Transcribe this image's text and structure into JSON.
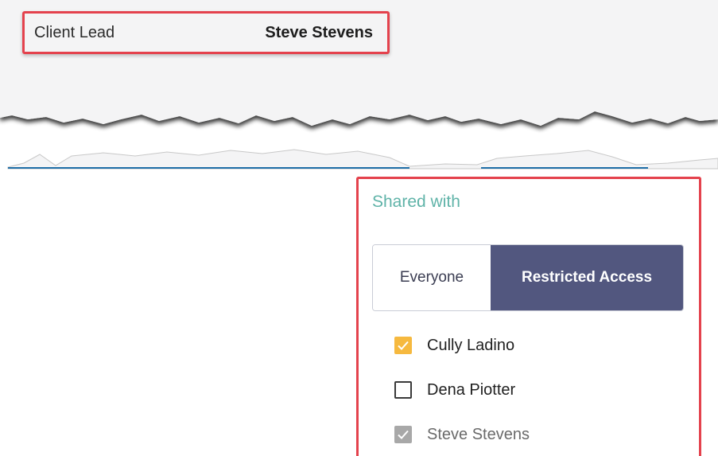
{
  "client_lead": {
    "label": "Client Lead",
    "value": "Steve Stevens"
  },
  "shared_with": {
    "title": "Shared with",
    "options": [
      {
        "label": "Everyone",
        "selected": false
      },
      {
        "label": "Restricted Access",
        "selected": true
      }
    ],
    "people": [
      {
        "name": "Cully Ladino",
        "checked": true,
        "disabled": false
      },
      {
        "name": "Dena Piotter",
        "checked": false,
        "disabled": false
      },
      {
        "name": "Steve Stevens",
        "checked": true,
        "disabled": true
      }
    ]
  },
  "colors": {
    "highlight_border": "#e4424d",
    "accent_title": "#5fb3a8",
    "segment_active": "#52577f",
    "checkbox_checked": "#f6b93f",
    "checkbox_disabled": "#a8a8a8",
    "divider_line": "#1f6fa8"
  }
}
